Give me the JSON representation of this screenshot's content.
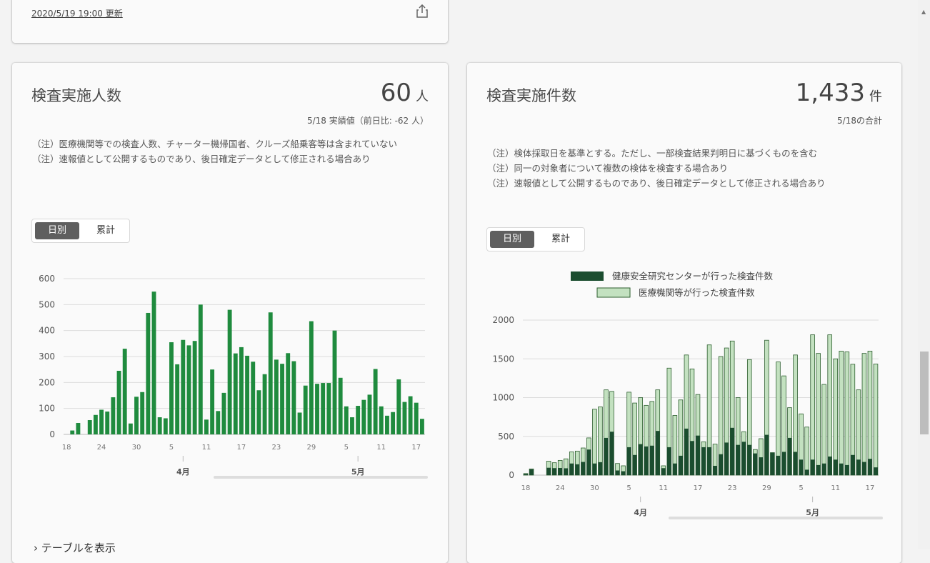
{
  "header_card": {
    "updated": "2020/5/19 19:00 更新"
  },
  "people_card": {
    "title": "検査実施人数",
    "value": "60",
    "unit": "人",
    "sub": "5/18 実績値（前日比: -62 人）",
    "notes": [
      "（注）医療機関等での検査人数、チャーター機帰国者、クルーズ船乗客等は含まれていない",
      "（注）速報値として公開するものであり、後日確定データとして修正される場合あり"
    ],
    "toggle": [
      "日別",
      "累計"
    ],
    "show_table": "テーブルを表示"
  },
  "tests_card": {
    "title": "検査実施件数",
    "value": "1,433",
    "unit": "件",
    "sub": "5/18の合計",
    "notes": [
      "（注）検体採取日を基準とする。ただし、一部検査結果判明日に基づくものを含む",
      "（注）同一の対象者について複数の検体を検査する場合あり",
      "（注）速報値として公開するものであり、後日確定データとして修正される場合あり"
    ],
    "toggle": [
      "日別",
      "累計"
    ]
  },
  "colors": {
    "bar_green": "#1f8b3e",
    "dark_green": "#1b4d2f",
    "light_green": "#c3e1c0",
    "bar_outline": "#2d5e2f"
  },
  "chart_data": [
    {
      "type": "bar",
      "categories": [
        "3/18",
        "3/19",
        "3/20",
        "3/21",
        "3/22",
        "3/23",
        "3/24",
        "3/25",
        "3/26",
        "3/27",
        "3/28",
        "3/29",
        "3/30",
        "3/31",
        "4/1",
        "4/2",
        "4/3",
        "4/4",
        "4/5",
        "4/6",
        "4/7",
        "4/8",
        "4/9",
        "4/10",
        "4/11",
        "4/12",
        "4/13",
        "4/14",
        "4/15",
        "4/16",
        "4/17",
        "4/18",
        "4/19",
        "4/20",
        "4/21",
        "4/22",
        "4/23",
        "4/24",
        "4/25",
        "4/26",
        "4/27",
        "4/28",
        "4/29",
        "4/30",
        "5/1",
        "5/2",
        "5/3",
        "5/4",
        "5/5",
        "5/6",
        "5/7",
        "5/8",
        "5/9",
        "5/10",
        "5/11",
        "5/12",
        "5/13",
        "5/14",
        "5/15",
        "5/16",
        "5/17",
        "5/18"
      ],
      "values": [
        0,
        15,
        44,
        0,
        55,
        75,
        95,
        88,
        143,
        245,
        330,
        42,
        145,
        163,
        468,
        550,
        66,
        62,
        355,
        270,
        364,
        343,
        360,
        500,
        57,
        250,
        90,
        160,
        480,
        312,
        336,
        303,
        280,
        170,
        232,
        470,
        288,
        272,
        313,
        282,
        84,
        188,
        436,
        195,
        198,
        198,
        400,
        218,
        108,
        66,
        110,
        133,
        153,
        252,
        108,
        72,
        86,
        212,
        125,
        147,
        122,
        60
      ],
      "ylim": [
        0,
        600
      ],
      "yticks": [
        0,
        100,
        200,
        300,
        400,
        500,
        600
      ],
      "xtick_labels": [
        "18",
        "24",
        "30",
        "5",
        "11",
        "17",
        "23",
        "29",
        "5",
        "11",
        "17"
      ],
      "month_labels": [
        "4月",
        "5月"
      ]
    },
    {
      "type": "bar",
      "stacked": true,
      "categories": [
        "3/18",
        "3/19",
        "3/20",
        "3/21",
        "3/22",
        "3/23",
        "3/24",
        "3/25",
        "3/26",
        "3/27",
        "3/28",
        "3/29",
        "3/30",
        "3/31",
        "4/1",
        "4/2",
        "4/3",
        "4/4",
        "4/5",
        "4/6",
        "4/7",
        "4/8",
        "4/9",
        "4/10",
        "4/11",
        "4/12",
        "4/13",
        "4/14",
        "4/15",
        "4/16",
        "4/17",
        "4/18",
        "4/19",
        "4/20",
        "4/21",
        "4/22",
        "4/23",
        "4/24",
        "4/25",
        "4/26",
        "4/27",
        "4/28",
        "4/29",
        "4/30",
        "5/1",
        "5/2",
        "5/3",
        "5/4",
        "5/5",
        "5/6",
        "5/7",
        "5/8",
        "5/9",
        "5/10",
        "5/11",
        "5/12",
        "5/13",
        "5/14",
        "5/15",
        "5/16",
        "5/17",
        "5/18"
      ],
      "series": [
        {
          "name": "健康安全研究センターが行った検査件数",
          "values": [
            15,
            75,
            0,
            0,
            95,
            90,
            92,
            88,
            150,
            140,
            170,
            330,
            150,
            167,
            480,
            560,
            60,
            50,
            360,
            260,
            400,
            370,
            380,
            570,
            90,
            360,
            150,
            250,
            600,
            440,
            510,
            360,
            360,
            120,
            270,
            420,
            610,
            390,
            430,
            390,
            280,
            230,
            520,
            300,
            250,
            300,
            480,
            300,
            200,
            70,
            200,
            130,
            150,
            240,
            200,
            150,
            130,
            260,
            200,
            170,
            210,
            100
          ],
          "total_values": [
            20,
            80,
            0,
            0,
            180,
            160,
            190,
            210,
            300,
            310,
            350,
            480,
            850,
            880,
            1100,
            1080,
            150,
            120,
            1070,
            930,
            1000,
            900,
            950,
            1100,
            120,
            1380,
            770,
            970,
            1550,
            1370,
            1040,
            430,
            1680,
            400,
            1530,
            1640,
            1730,
            1000,
            560,
            1490,
            330,
            470,
            1740,
            290,
            1460,
            1280,
            870,
            1550,
            790,
            620,
            1810,
            1570,
            1170,
            1810,
            1500,
            1600,
            1590,
            1430,
            1100,
            1570,
            1600,
            1433
          ]
        },
        {
          "name": "医療機関等が行った検査件数",
          "values": [
            5,
            5,
            0,
            0,
            85,
            70,
            98,
            122,
            150,
            170,
            180,
            150,
            700,
            713,
            620,
            520,
            90,
            70,
            710,
            670,
            600,
            530,
            570,
            530,
            30,
            1020,
            620,
            720,
            950,
            930,
            530,
            70,
            1320,
            280,
            1260,
            1220,
            1120,
            610,
            130,
            1100,
            50,
            240,
            1220,
            -10,
            1210,
            980,
            390,
            1250,
            590,
            550,
            1610,
            1440,
            1020,
            1570,
            1300,
            1450,
            1460,
            1170,
            900,
            1400,
            1390,
            1333
          ]
        }
      ],
      "ylim": [
        0,
        2000
      ],
      "yticks": [
        0,
        500,
        1000,
        1500,
        2000
      ],
      "xtick_labels": [
        "18",
        "24",
        "30",
        "5",
        "11",
        "17",
        "23",
        "29",
        "5",
        "11",
        "17"
      ],
      "month_labels": [
        "4月",
        "5月"
      ],
      "legend": "top"
    }
  ]
}
